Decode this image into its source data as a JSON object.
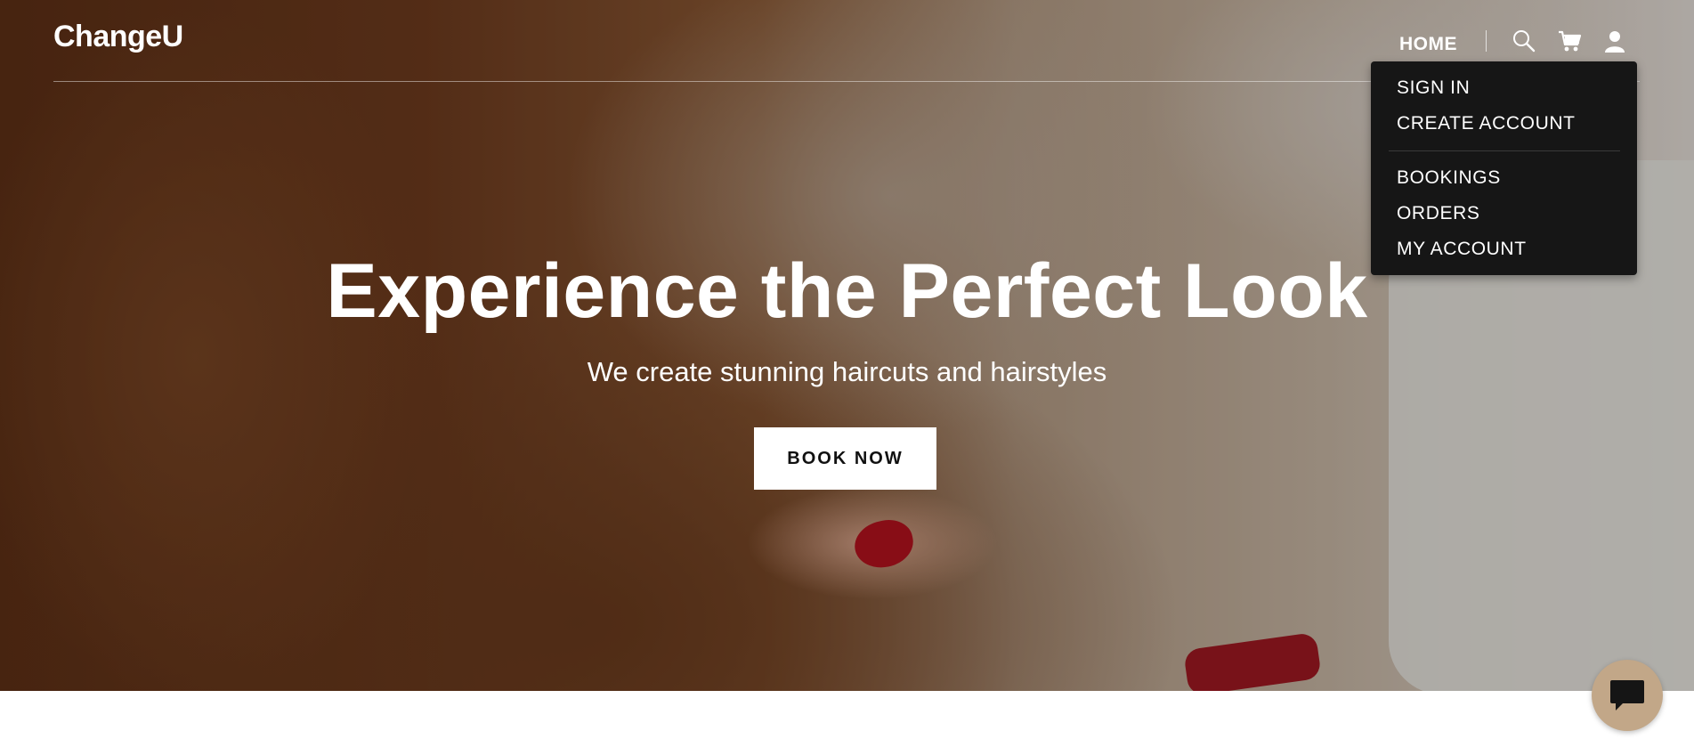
{
  "header": {
    "logo": "ChangeU",
    "nav": {
      "home": "HOME"
    },
    "icons": [
      "search-icon",
      "cart-icon",
      "account-icon"
    ]
  },
  "account_menu": {
    "items": [
      {
        "label": "SIGN IN"
      },
      {
        "label": "CREATE ACCOUNT"
      },
      {
        "label": "BOOKINGS"
      },
      {
        "label": "ORDERS"
      },
      {
        "label": "MY ACCOUNT"
      }
    ]
  },
  "hero": {
    "title": "Experience the Perfect Look",
    "subtitle": "We create stunning haircuts and hairstyles",
    "cta": "BOOK NOW"
  },
  "chat": {
    "icon": "chat-icon"
  },
  "colors": {
    "accent_bar": "#1f9a93",
    "menu_bg": "#161616",
    "chat_button": "#c2a788",
    "button_bg": "#ffffff"
  }
}
